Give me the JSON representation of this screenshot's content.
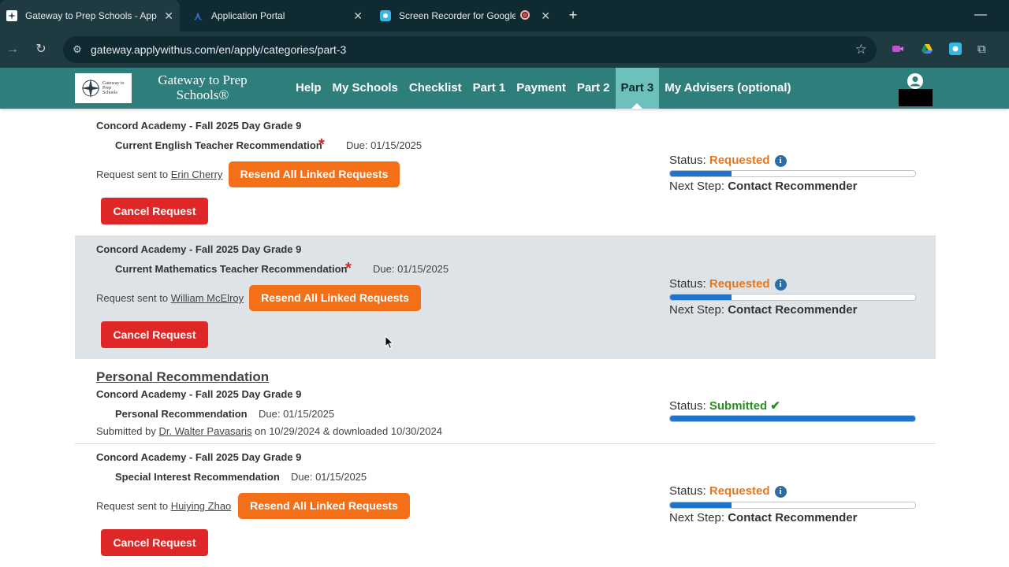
{
  "browser": {
    "tabs": [
      {
        "title": "Gateway to Prep Schools - App",
        "favicon": "gateway-icon",
        "active": true
      },
      {
        "title": "Application Portal",
        "favicon": "a-logo-icon",
        "active": false
      },
      {
        "title": "Screen Recorder for Google",
        "favicon": "screen-recorder-icon",
        "active": false
      }
    ],
    "url": "gateway.applywithus.com/en/apply/categories/part-3"
  },
  "site": {
    "brand_line1": "Gateway to Prep",
    "brand_line2": "Schools®",
    "logo_text": "Gateway to Prep Schools",
    "nav": [
      "Help",
      "My Schools",
      "Checklist",
      "Part 1",
      "Payment",
      "Part 2",
      "Part 3",
      "My Advisers (optional)"
    ],
    "active_nav": "Part 3"
  },
  "recommendations": [
    {
      "school": "Concord Academy - Fall 2025 Day Grade 9",
      "name": "Current English Teacher Recommendation",
      "required": true,
      "due": "Due: 01/15/2025",
      "sent_prefix": "Request sent to",
      "recommender": "Erin Cherry",
      "resend_label": "Resend All Linked Requests",
      "cancel_label": "Cancel Request",
      "status_label": "Status:",
      "status": "Requested",
      "progress": 0.25,
      "next_label": "Next Step:",
      "next_step": "Contact Recommender"
    },
    {
      "school": "Concord Academy - Fall 2025 Day Grade 9",
      "name": "Current Mathematics Teacher Recommendation",
      "required": true,
      "due": "Due: 01/15/2025",
      "sent_prefix": "Request sent to",
      "recommender": "William McElroy",
      "resend_label": "Resend All Linked Requests",
      "cancel_label": "Cancel Request",
      "status_label": "Status:",
      "status": "Requested",
      "progress": 0.25,
      "next_label": "Next Step:",
      "next_step": "Contact Recommender"
    },
    {
      "heading": "Personal Recommendation",
      "school": "Concord Academy - Fall 2025 Day Grade 9",
      "name": "Personal Recommendation",
      "required": false,
      "due": "Due: 01/15/2025",
      "submitted_prefix": "Submitted by",
      "recommender": "Dr. Walter Pavasaris",
      "submitted_suffix": "on 10/29/2024 & downloaded 10/30/2024",
      "status_label": "Status:",
      "status": "Submitted",
      "progress": 1.0
    },
    {
      "school": "Concord Academy - Fall 2025 Day Grade 9",
      "name": "Special Interest Recommendation",
      "required": false,
      "due": "Due: 01/15/2025",
      "sent_prefix": "Request sent to",
      "recommender": "Huiying Zhao",
      "resend_label": "Resend All Linked Requests",
      "cancel_label": "Cancel Request",
      "status_label": "Status:",
      "status": "Requested",
      "progress": 0.25,
      "next_label": "Next Step:",
      "next_step": "Contact Recommender"
    }
  ],
  "colors": {
    "site_nav": "#2e7f7c",
    "active_nav": "#6ec0bd",
    "resend_button": "#f37018",
    "cancel_button": "#e02727",
    "status_requested": "#e7771f",
    "status_submitted": "#28901f",
    "progress_fill": "#1f73c8"
  }
}
